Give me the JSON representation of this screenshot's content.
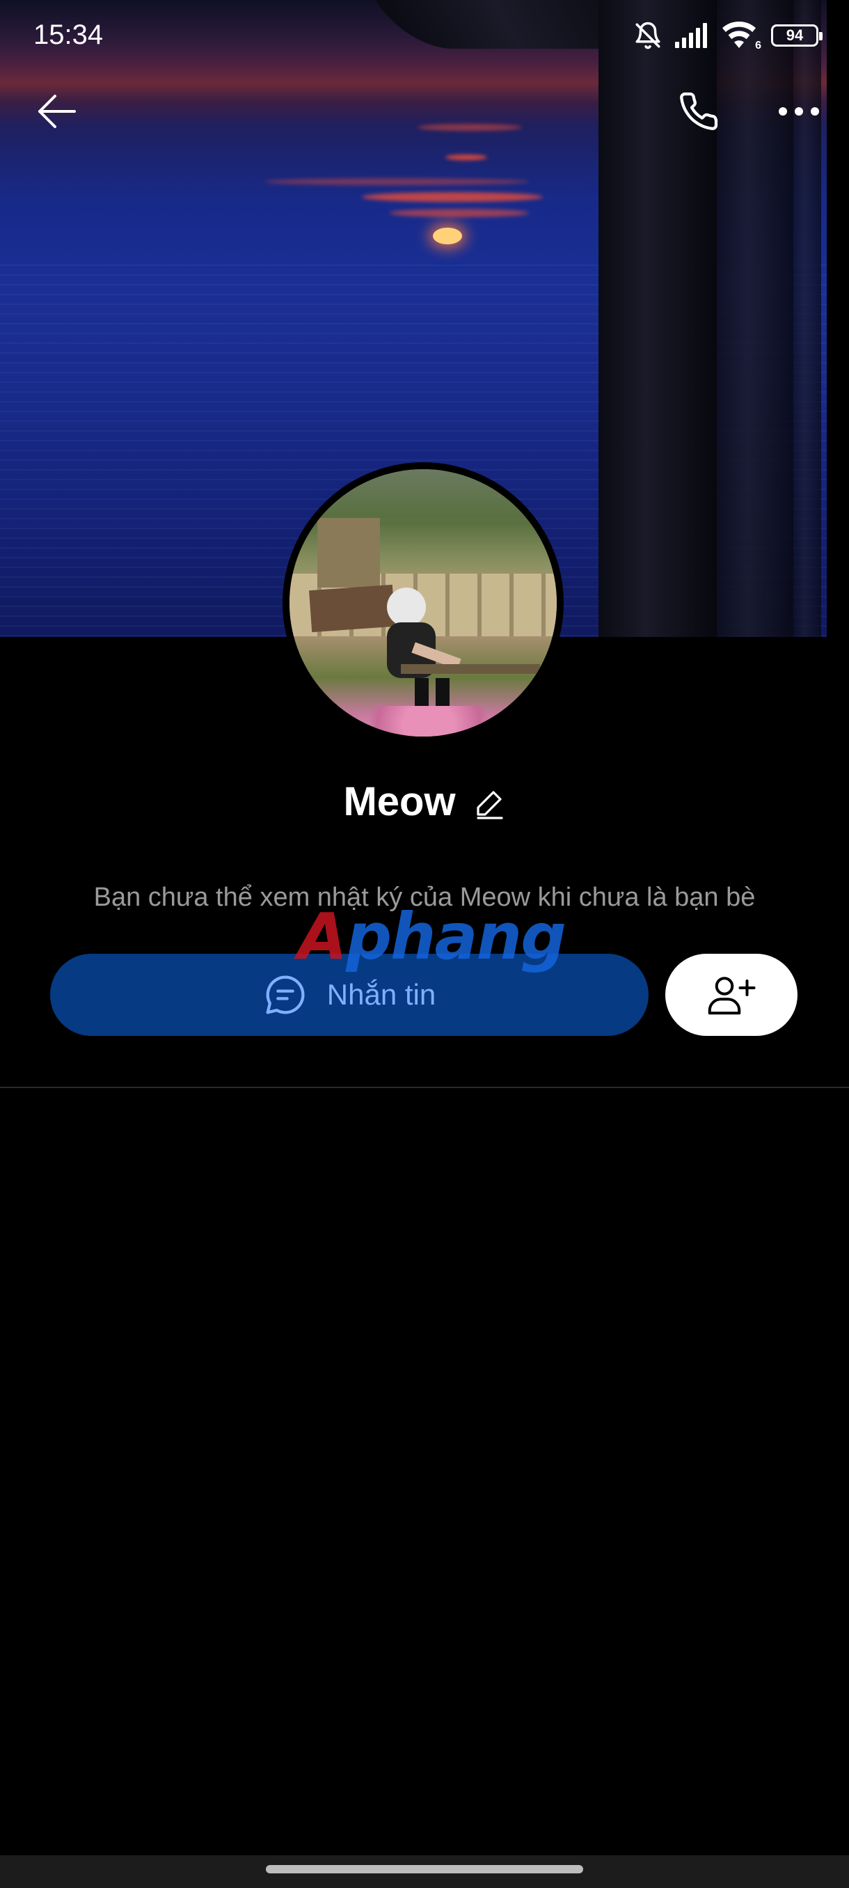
{
  "status_bar": {
    "time": "15:34",
    "battery": "94",
    "wifi_badge": "6",
    "icons": [
      "bell-muted-icon",
      "signal-icon",
      "wifi-icon",
      "battery-icon"
    ]
  },
  "header": {
    "back_icon": "arrow-left-icon",
    "call_icon": "phone-icon",
    "more_icon": "more-horizontal-icon"
  },
  "profile": {
    "name": "Meow",
    "edit_icon": "pencil-icon",
    "notice": "Bạn chưa thể xem nhật ký của Meow khi chưa là bạn bè"
  },
  "actions": {
    "message_label": "Nhắn tin",
    "message_icon": "chat-bubble-icon",
    "add_friend_icon": "user-plus-icon"
  },
  "watermark": {
    "first": "A",
    "rest": "phang"
  },
  "colors": {
    "background": "#000000",
    "message_button": "#063a82",
    "message_text": "#7fb0ff",
    "notice_text": "#9a9a9a"
  }
}
